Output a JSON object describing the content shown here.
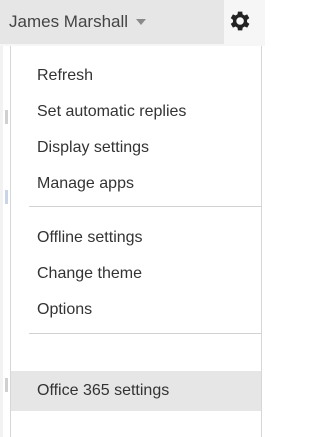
{
  "header": {
    "user_name": "James Marshall",
    "dropdown_icon": "caret-down-icon",
    "settings_icon": "gear-icon"
  },
  "menu": {
    "groups": [
      [
        "Refresh",
        "Set automatic replies",
        "Display settings",
        "Manage apps"
      ],
      [
        "Offline settings",
        "Change theme",
        "Options"
      ],
      [
        "Office 365 settings"
      ]
    ]
  },
  "colors": {
    "highlight": "#e6e6e6",
    "text": "#333333"
  }
}
